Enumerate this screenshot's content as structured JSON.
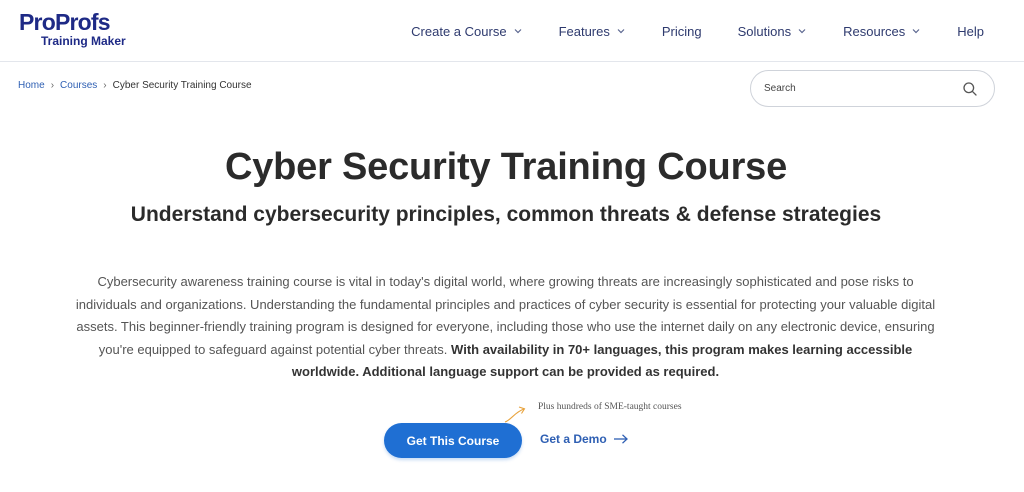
{
  "logo": {
    "main": "ProProfs",
    "sub": "Training Maker"
  },
  "nav": [
    {
      "label": "Create a Course",
      "dropdown": true
    },
    {
      "label": "Features",
      "dropdown": true
    },
    {
      "label": "Pricing",
      "dropdown": false
    },
    {
      "label": "Solutions",
      "dropdown": true
    },
    {
      "label": "Resources",
      "dropdown": true
    },
    {
      "label": "Help",
      "dropdown": false
    }
  ],
  "breadcrumb": {
    "home": "Home",
    "courses": "Courses",
    "current": "Cyber Security Training Course"
  },
  "search": {
    "placeholder": "Search",
    "icon": "search-icon"
  },
  "hero": {
    "title": "Cyber Security Training Course",
    "subtitle": "Understand cybersecurity principles, common threats & defense strategies",
    "description": "Cybersecurity awareness training course is vital in today's digital world, where growing threats are increasingly sophisticated and pose risks to individuals and organizations. Understanding the fundamental principles and practices of cyber security is essential for protecting your valuable digital assets. This beginner-friendly training program is designed for everyone, including those who use the internet daily on any electronic device, ensuring you're equipped to safeguard against potential cyber threats.",
    "description_bold": "With availability in 70+ languages, this program makes learning accessible worldwide. Additional language support can be provided as required.",
    "note": "Plus hundreds of SME-taught courses",
    "cta_primary": "Get This Course",
    "cta_secondary": "Get a Demo"
  },
  "colors": {
    "brand": "#1e2a86",
    "primary_button": "#1f6fd3",
    "link": "#2e5fb3",
    "note_arrow": "#e8a33d"
  }
}
